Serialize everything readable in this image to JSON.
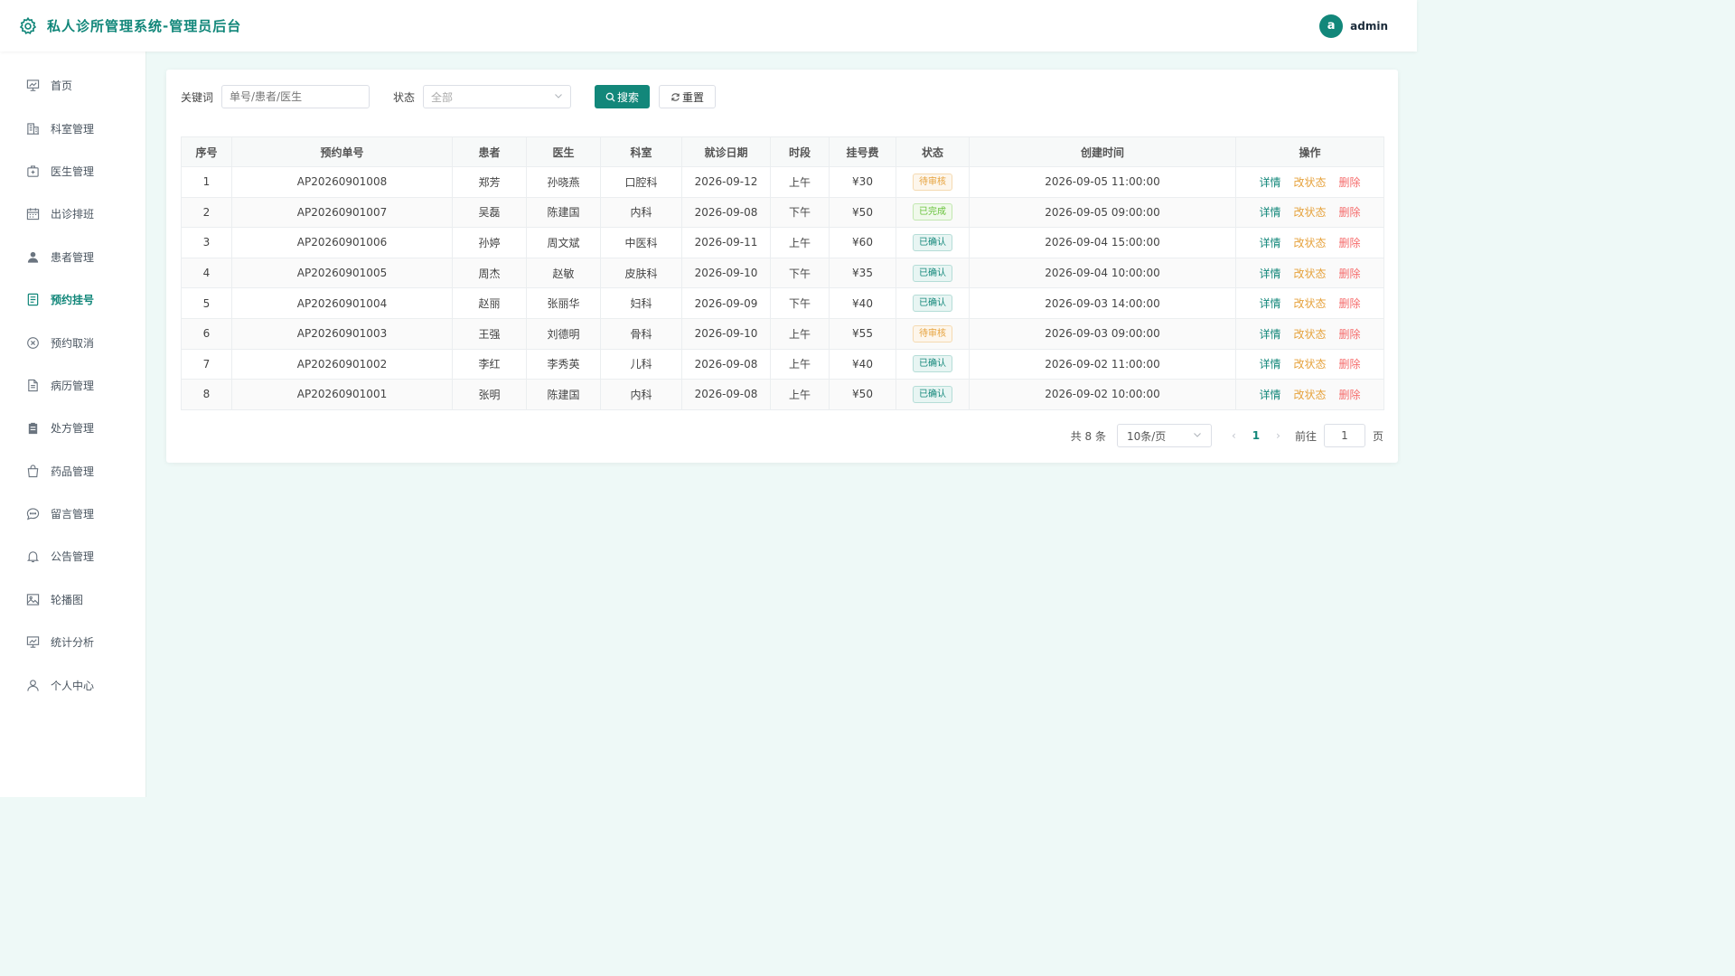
{
  "header": {
    "title": "私人诊所管理系统-管理员后台",
    "avatar_letter": "a",
    "username": "admin"
  },
  "sidebar": {
    "items": [
      {
        "label": "首页",
        "icon": "chart-board-icon"
      },
      {
        "label": "科室管理",
        "icon": "building-icon"
      },
      {
        "label": "医生管理",
        "icon": "medkit-icon"
      },
      {
        "label": "出诊排班",
        "icon": "calendar-icon"
      },
      {
        "label": "患者管理",
        "icon": "user-icon"
      },
      {
        "label": "预约挂号",
        "icon": "document-icon"
      },
      {
        "label": "预约取消",
        "icon": "circle-close-icon"
      },
      {
        "label": "病历管理",
        "icon": "file-icon"
      },
      {
        "label": "处方管理",
        "icon": "clipboard-icon"
      },
      {
        "label": "药品管理",
        "icon": "bag-icon"
      },
      {
        "label": "留言管理",
        "icon": "chat-icon"
      },
      {
        "label": "公告管理",
        "icon": "bell-icon"
      },
      {
        "label": "轮播图",
        "icon": "picture-icon"
      },
      {
        "label": "统计分析",
        "icon": "chart-board-icon"
      },
      {
        "label": "个人中心",
        "icon": "user-outline-icon"
      }
    ],
    "active_index": 5
  },
  "filters": {
    "keyword_label": "关键词",
    "keyword_placeholder": "单号/患者/医生",
    "status_label": "状态",
    "status_value": "全部",
    "search_label": "搜索",
    "reset_label": "重置"
  },
  "table": {
    "headers": [
      "序号",
      "预约单号",
      "患者",
      "医生",
      "科室",
      "就诊日期",
      "时段",
      "挂号费",
      "状态",
      "创建时间",
      "操作"
    ],
    "rows": [
      {
        "no": "1",
        "order": "AP20260901008",
        "patient": "郑芳",
        "doctor": "孙晓燕",
        "dept": "口腔科",
        "date": "2026-09-12",
        "period": "上午",
        "fee": "¥30",
        "status": "待审核",
        "status_type": "pending",
        "created": "2026-09-05 11:00:00"
      },
      {
        "no": "2",
        "order": "AP20260901007",
        "patient": "吴磊",
        "doctor": "陈建国",
        "dept": "内科",
        "date": "2026-09-08",
        "period": "下午",
        "fee": "¥50",
        "status": "已完成",
        "status_type": "done",
        "created": "2026-09-05 09:00:00"
      },
      {
        "no": "3",
        "order": "AP20260901006",
        "patient": "孙婷",
        "doctor": "周文斌",
        "dept": "中医科",
        "date": "2026-09-11",
        "period": "上午",
        "fee": "¥60",
        "status": "已确认",
        "status_type": "confirmed",
        "created": "2026-09-04 15:00:00"
      },
      {
        "no": "4",
        "order": "AP20260901005",
        "patient": "周杰",
        "doctor": "赵敏",
        "dept": "皮肤科",
        "date": "2026-09-10",
        "period": "下午",
        "fee": "¥35",
        "status": "已确认",
        "status_type": "confirmed",
        "created": "2026-09-04 10:00:00"
      },
      {
        "no": "5",
        "order": "AP20260901004",
        "patient": "赵丽",
        "doctor": "张丽华",
        "dept": "妇科",
        "date": "2026-09-09",
        "period": "下午",
        "fee": "¥40",
        "status": "已确认",
        "status_type": "confirmed",
        "created": "2026-09-03 14:00:00"
      },
      {
        "no": "6",
        "order": "AP20260901003",
        "patient": "王强",
        "doctor": "刘德明",
        "dept": "骨科",
        "date": "2026-09-10",
        "period": "上午",
        "fee": "¥55",
        "status": "待审核",
        "status_type": "pending",
        "created": "2026-09-03 09:00:00"
      },
      {
        "no": "7",
        "order": "AP20260901002",
        "patient": "李红",
        "doctor": "李秀英",
        "dept": "儿科",
        "date": "2026-09-08",
        "period": "上午",
        "fee": "¥40",
        "status": "已确认",
        "status_type": "confirmed",
        "created": "2026-09-02 11:00:00"
      },
      {
        "no": "8",
        "order": "AP20260901001",
        "patient": "张明",
        "doctor": "陈建国",
        "dept": "内科",
        "date": "2026-09-08",
        "period": "上午",
        "fee": "¥50",
        "status": "已确认",
        "status_type": "confirmed",
        "created": "2026-09-02 10:00:00"
      }
    ],
    "actions": {
      "detail": "详情",
      "change_status": "改状态",
      "delete": "删除"
    }
  },
  "pagination": {
    "total_text": "共 8 条",
    "page_size": "10条/页",
    "current_page": "1",
    "goto_label": "前往",
    "goto_value": "1",
    "page_suffix": "页"
  },
  "colors": {
    "accent": "#12877a",
    "background": "#eef9f7",
    "warning": "#e6a23c",
    "success": "#67c23a",
    "danger": "#f56c6c"
  }
}
